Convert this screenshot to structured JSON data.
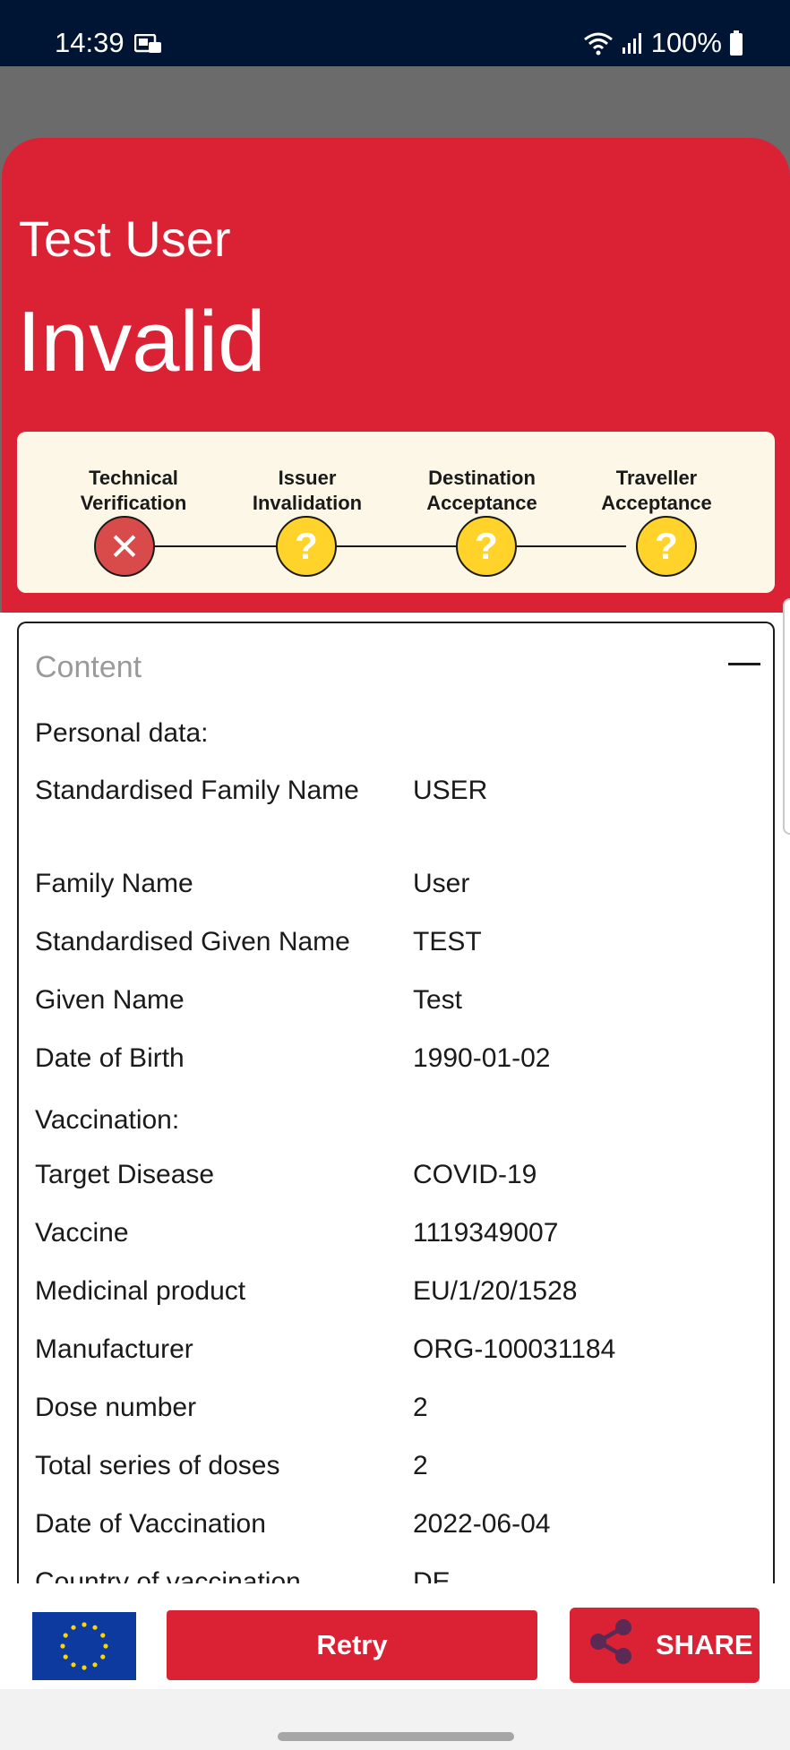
{
  "status_bar": {
    "time": "14:39",
    "battery": "100%"
  },
  "header": {
    "owner_name": "Test User",
    "status": "Invalid",
    "background_color": "#db2134"
  },
  "verification_steps": [
    {
      "label_line1": "Technical",
      "label_line2": "Verification",
      "state": "failed",
      "symbol": "✕"
    },
    {
      "label_line1": "Issuer",
      "label_line2": "Invalidation",
      "state": "unknown",
      "symbol": "?"
    },
    {
      "label_line1": "Destination",
      "label_line2": "Acceptance",
      "state": "unknown",
      "symbol": "?"
    },
    {
      "label_line1": "Traveller",
      "label_line2": "Acceptance",
      "state": "unknown",
      "symbol": "?"
    }
  ],
  "content": {
    "header": "Content",
    "personal_section": "Personal data:",
    "personal": [
      {
        "label": "Standardised Family Name",
        "value": "USER"
      },
      {
        "label": "Family Name",
        "value": "User"
      },
      {
        "label": "Standardised Given Name",
        "value": "TEST"
      },
      {
        "label": "Given Name",
        "value": "Test"
      },
      {
        "label": "Date of Birth",
        "value": "1990-01-02"
      }
    ],
    "vaccination_section": "Vaccination:",
    "vaccination": [
      {
        "label": "Target Disease",
        "value": "COVID-19"
      },
      {
        "label": "Vaccine",
        "value": "1119349007"
      },
      {
        "label": "Medicinal product",
        "value": "EU/1/20/1528"
      },
      {
        "label": "Manufacturer",
        "value": "ORG-100031184"
      },
      {
        "label": "Dose number",
        "value": "2"
      },
      {
        "label": "Total series of doses",
        "value": "2"
      },
      {
        "label": "Date of Vaccination",
        "value": "2022-06-04"
      },
      {
        "label": "Country of vaccination",
        "value": "DE"
      }
    ]
  },
  "bottom_bar": {
    "retry_label": "Retry",
    "share_label": "SHARE"
  },
  "icons": {
    "status_notification": "sim-card-icon",
    "wifi": "wifi-icon",
    "signal": "signal-icon",
    "battery": "battery-icon",
    "flag": "eu-flag-icon",
    "share": "share-icon",
    "collapse": "minus-icon"
  }
}
